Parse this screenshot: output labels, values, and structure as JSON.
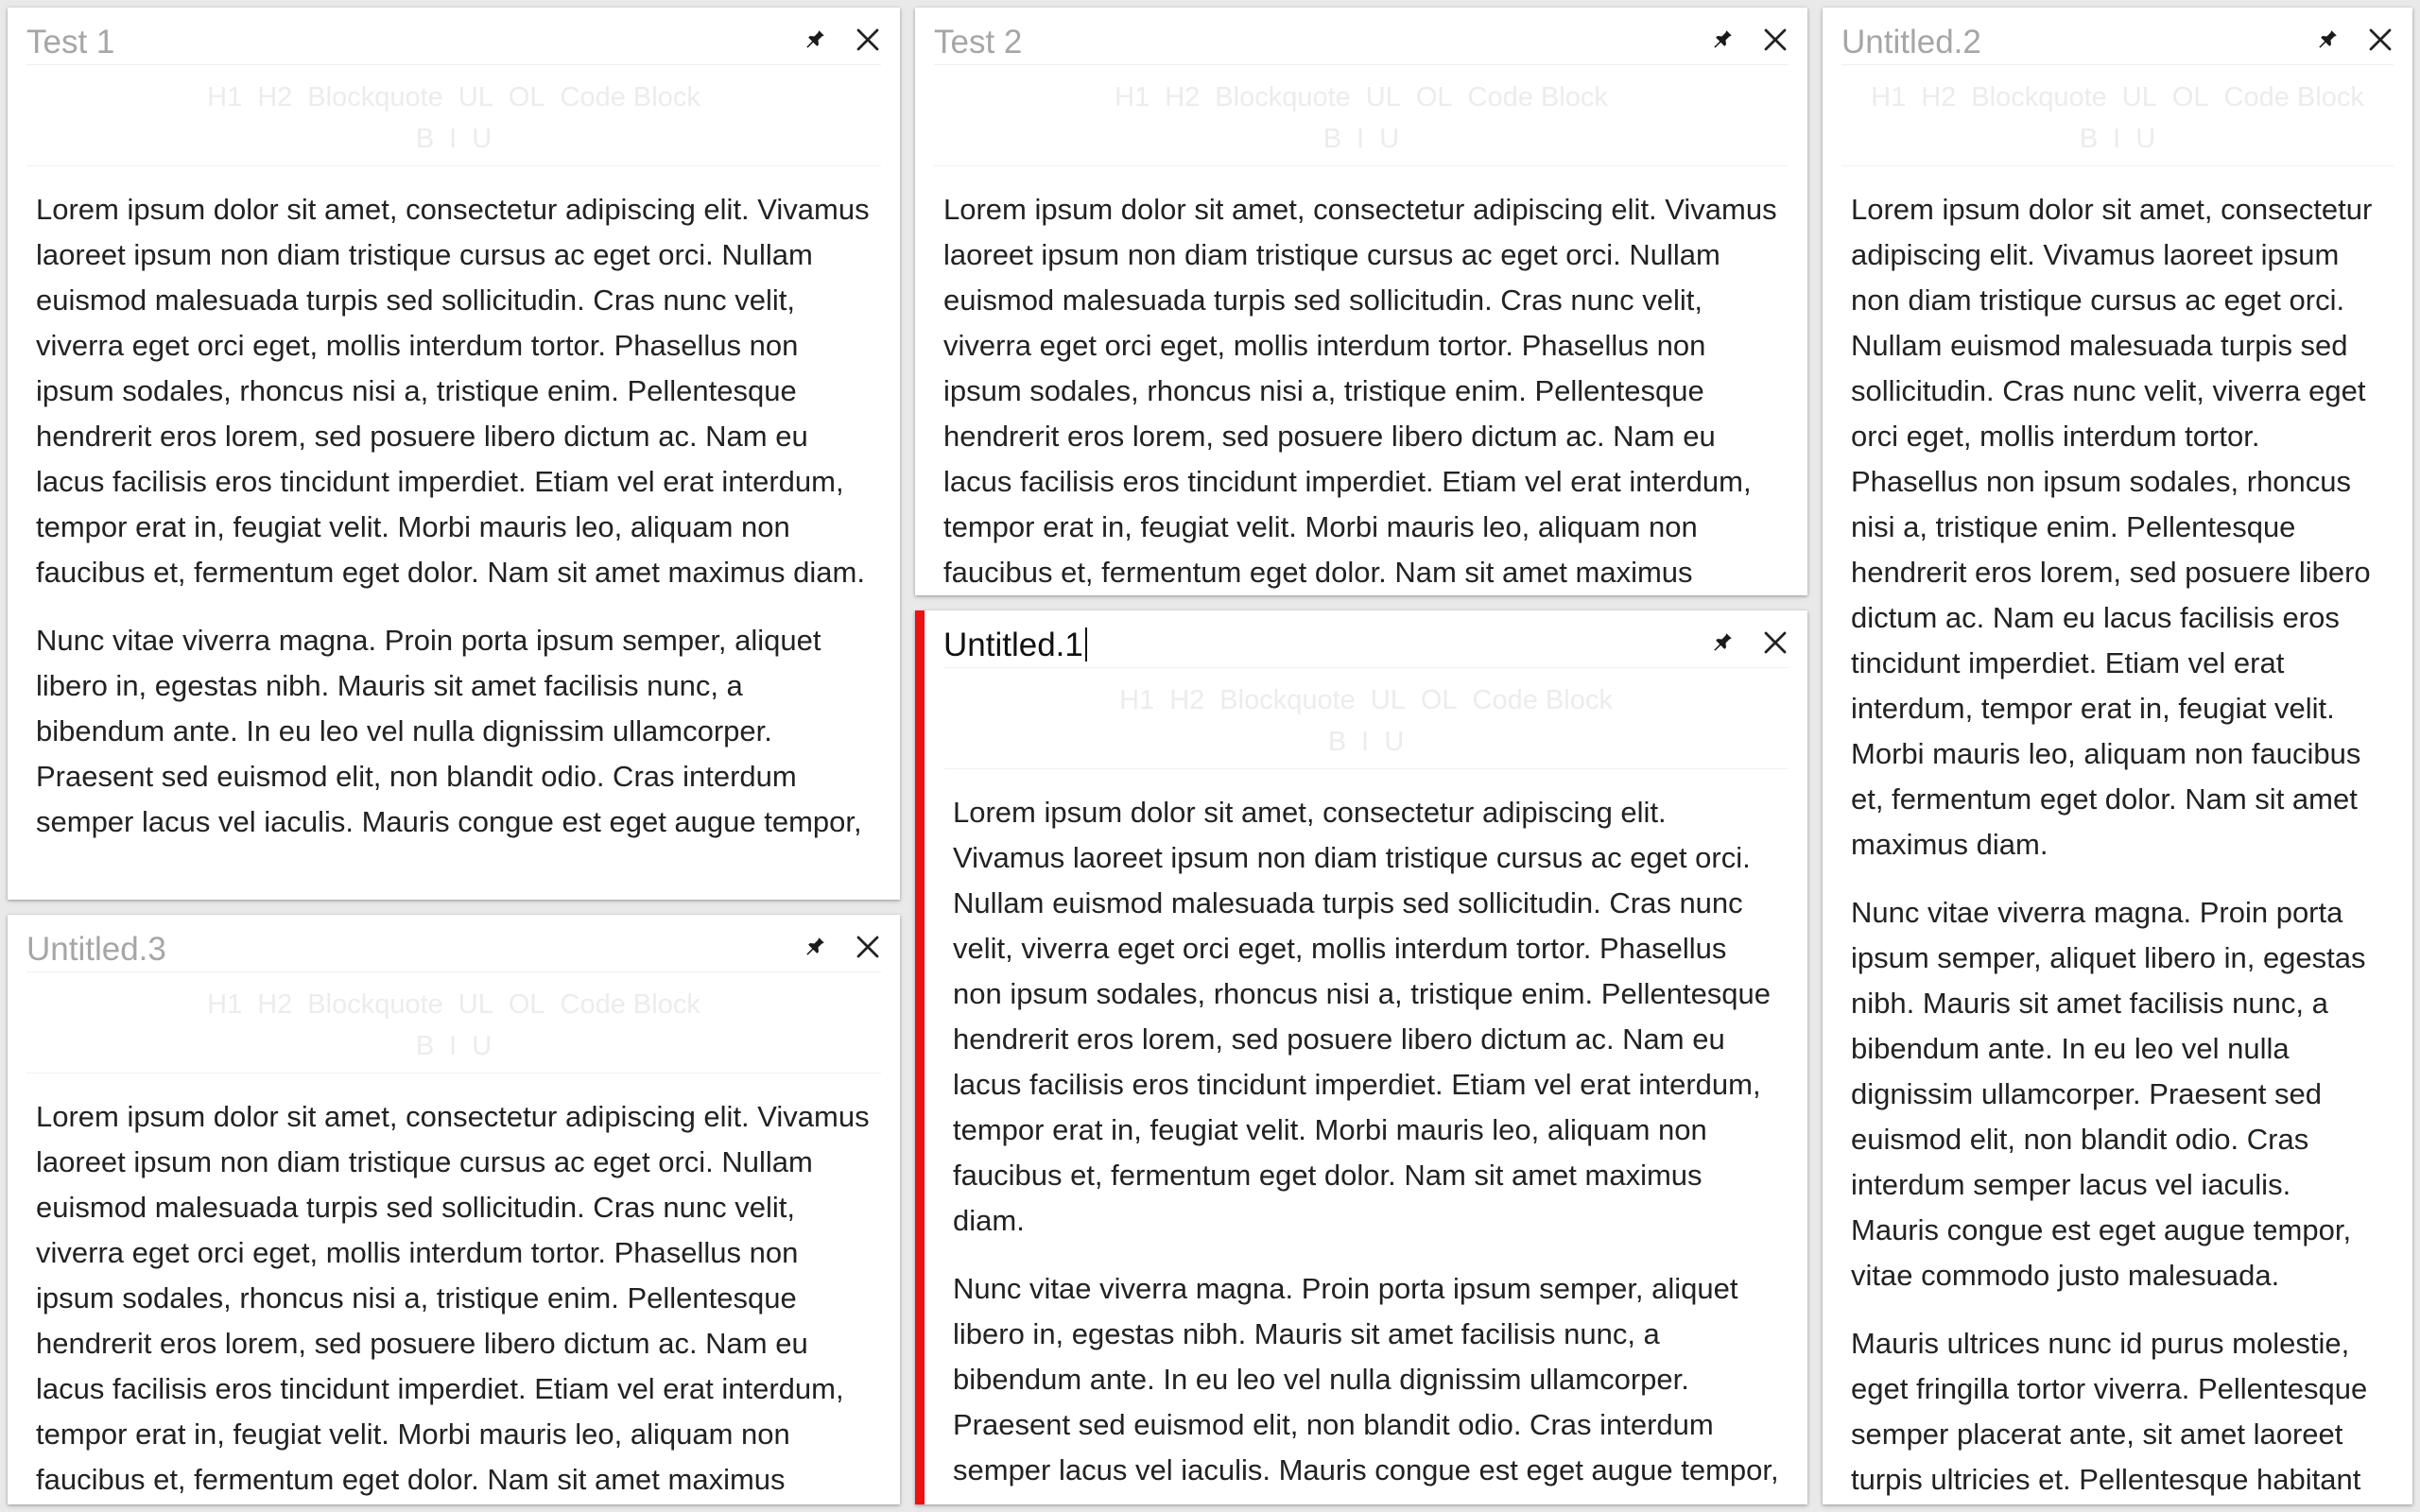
{
  "toolbar": {
    "row1": [
      "H1",
      "H2",
      "Blockquote",
      "UL",
      "OL",
      "Code Block"
    ],
    "row2": [
      "B",
      "I",
      "U"
    ]
  },
  "notes": [
    {
      "id": "test-1",
      "title": "Test 1",
      "active": false,
      "paragraphs": [
        "Lorem ipsum dolor sit amet, consectetur adipiscing elit. Vivamus laoreet ipsum non diam tristique cursus ac eget orci. Nullam euismod malesuada turpis sed sollicitudin. Cras nunc velit, viverra eget orci eget, mollis interdum tortor. Phasellus non ipsum sodales, rhoncus nisi a, tristique enim. Pellentesque hendrerit eros lorem, sed posuere libero dictum ac. Nam eu lacus facilisis eros tincidunt imperdiet. Etiam vel erat interdum, tempor erat in, feugiat velit. Morbi mauris leo, aliquam non faucibus et, fermentum eget dolor. Nam sit amet maximus diam.",
        "Nunc vitae viverra magna. Proin porta ipsum semper, aliquet libero in, egestas nibh. Mauris sit amet facilisis nunc, a bibendum ante. In eu leo vel nulla dignissim ullamcorper. Praesent sed euismod elit, non blandit odio. Cras interdum semper lacus vel iaculis. Mauris congue est eget augue tempor,"
      ]
    },
    {
      "id": "untitled-3",
      "title": "Untitled.3",
      "active": false,
      "paragraphs": [
        "Lorem ipsum dolor sit amet, consectetur adipiscing elit. Vivamus laoreet ipsum non diam tristique cursus ac eget orci. Nullam euismod malesuada turpis sed sollicitudin. Cras nunc velit, viverra eget orci eget, mollis interdum tortor. Phasellus non ipsum sodales, rhoncus nisi a, tristique enim. Pellentesque hendrerit eros lorem, sed posuere libero dictum ac. Nam eu lacus facilisis eros tincidunt imperdiet. Etiam vel erat interdum, tempor erat in, feugiat velit. Morbi mauris leo, aliquam non faucibus et, fermentum eget dolor. Nam sit amet maximus"
      ]
    },
    {
      "id": "test-2",
      "title": "Test 2",
      "active": false,
      "paragraphs": [
        "Lorem ipsum dolor sit amet, consectetur adipiscing elit. Vivamus laoreet ipsum non diam tristique cursus ac eget orci. Nullam euismod malesuada turpis sed sollicitudin. Cras nunc velit, viverra eget orci eget, mollis interdum tortor. Phasellus non ipsum sodales, rhoncus nisi a, tristique enim. Pellentesque hendrerit eros lorem, sed posuere libero dictum ac. Nam eu lacus facilisis eros tincidunt imperdiet. Etiam vel erat interdum, tempor erat in, feugiat velit. Morbi mauris leo, aliquam non faucibus et, fermentum eget dolor. Nam sit amet maximus"
      ]
    },
    {
      "id": "untitled-1",
      "title": "Untitled.1",
      "active": true,
      "paragraphs": [
        "Lorem ipsum dolor sit amet, consectetur adipiscing elit. Vivamus laoreet ipsum non diam tristique cursus ac eget orci. Nullam euismod malesuada turpis sed sollicitudin. Cras nunc velit, viverra eget orci eget, mollis interdum tortor. Phasellus non ipsum sodales, rhoncus nisi a, tristique enim. Pellentesque hendrerit eros lorem, sed posuere libero dictum ac. Nam eu lacus facilisis eros tincidunt imperdiet. Etiam vel erat interdum, tempor erat in, feugiat velit. Morbi mauris leo, aliquam non faucibus et, fermentum eget dolor. Nam sit amet maximus diam.",
        "Nunc vitae viverra magna. Proin porta ipsum semper, aliquet libero in, egestas nibh. Mauris sit amet facilisis nunc, a bibendum ante. In eu leo vel nulla dignissim ullamcorper. Praesent sed euismod elit, non blandit odio. Cras interdum semper lacus vel iaculis. Mauris congue est eget augue tempor,"
      ]
    },
    {
      "id": "untitled-2",
      "title": "Untitled.2",
      "active": false,
      "paragraphs": [
        "Lorem ipsum dolor sit amet, consectetur adipiscing elit. Vivamus laoreet ipsum non diam tristique cursus ac eget orci. Nullam euismod malesuada turpis sed sollicitudin. Cras nunc velit, viverra eget orci eget, mollis interdum tortor. Phasellus non ipsum sodales, rhoncus nisi a, tristique enim. Pellentesque hendrerit eros lorem, sed posuere libero dictum ac. Nam eu lacus facilisis eros tincidunt imperdiet. Etiam vel erat interdum, tempor erat in, feugiat velit. Morbi mauris leo, aliquam non faucibus et, fermentum eget dolor. Nam sit amet maximus diam.",
        "Nunc vitae viverra magna. Proin porta ipsum semper, aliquet libero in, egestas nibh. Mauris sit amet facilisis nunc, a bibendum ante. In eu leo vel nulla dignissim ullamcorper. Praesent sed euismod elit, non blandit odio. Cras interdum semper lacus vel iaculis. Mauris congue est eget augue tempor, vitae commodo justo malesuada.",
        "Mauris ultrices nunc id purus molestie, eget fringilla tortor viverra. Pellentesque semper placerat ante, sit amet laoreet turpis ultricies et. Pellentesque habitant"
      ]
    }
  ]
}
